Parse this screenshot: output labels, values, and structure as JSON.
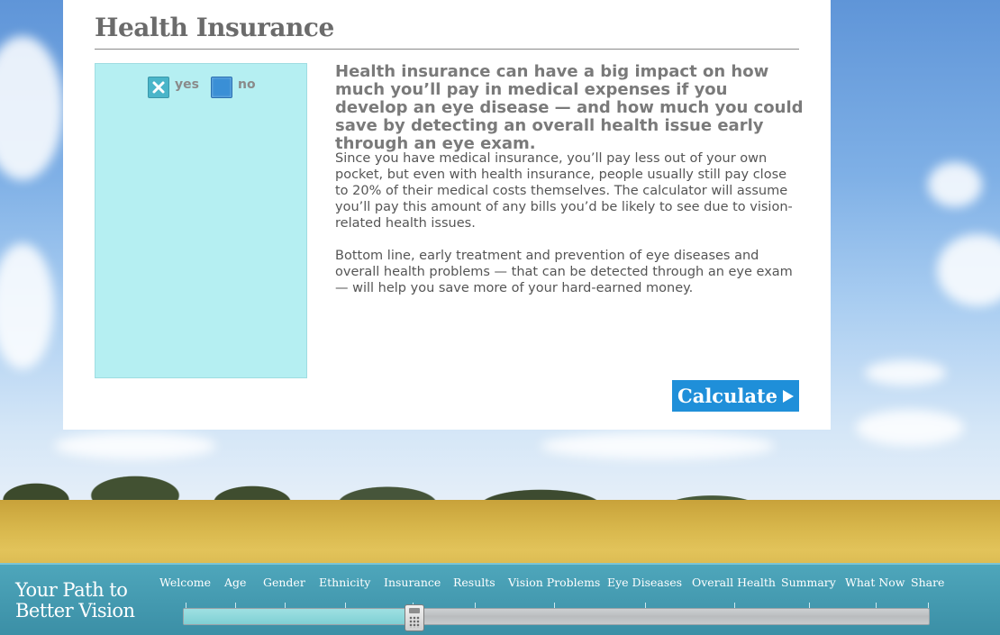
{
  "page": {
    "title": "Health Insurance"
  },
  "insurance_choice": {
    "yes_label": "yes",
    "no_label": "no",
    "selected": "yes"
  },
  "content": {
    "intro": "Health insurance can have a big impact on how much you’ll pay in medical expenses if you develop an eye disease — and how much you could save by detecting an overall health issue early through an eye exam.",
    "paragraph1": "Since you have medical insurance, you’ll pay less out of your own pocket, but even with health insurance, people usually still pay close to 20% of their medical costs themselves. The calculator will assume you’ll pay this amount of any bills you’d be likely to see due to vision-related health issues.",
    "paragraph2": "Bottom line, early treatment and prevention of eye diseases and overall health problems — that can be detected through an eye exam — will help you save more of your hard-earned money."
  },
  "calculate_button": {
    "label": "Calculate",
    "icon": "play-arrow-icon"
  },
  "navigation": {
    "brand_line1": "Your Path to",
    "brand_line2": "Better Vision",
    "steps": [
      "Welcome",
      "Age",
      "Gender",
      "Ethnicity",
      "Insurance",
      "Results",
      "Vision Problems",
      "Eye Diseases",
      "Overall Health",
      "Summary",
      "What Now",
      "Share"
    ],
    "current_step": "Insurance",
    "progress_fraction": 0.31,
    "handle_icon": "calculator-icon"
  },
  "colors": {
    "accent_blue": "#1f8fd9",
    "panel_teal": "#b5eff2",
    "nav_teal": "#4ea6bb",
    "heading_gray": "#6b6b6b"
  }
}
